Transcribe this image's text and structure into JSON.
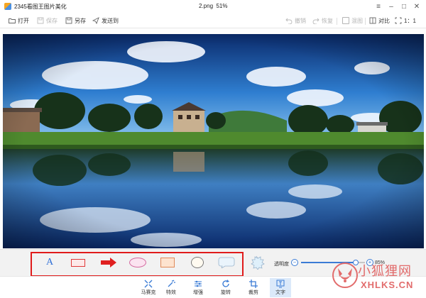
{
  "window": {
    "app_title": "2345看图王图片美化",
    "file_title": "2.png",
    "zoom": "51%"
  },
  "toolbar": {
    "open": "打开",
    "save": "保存",
    "save_as": "另存",
    "send_to": "发送到",
    "undo": "撤销",
    "redo": "恢复",
    "template": "混图",
    "compare": "对比",
    "ratio": "1：1"
  },
  "annotation": {
    "text_tool": "A",
    "opacity_label": "透明度",
    "opacity_value": "85%",
    "opacity_level": 0.85
  },
  "bottom_tabs": [
    {
      "label": "马赛克",
      "icon": "mosaic-icon"
    },
    {
      "label": "特效",
      "icon": "effects-icon"
    },
    {
      "label": "增强",
      "icon": "enhance-icon"
    },
    {
      "label": "旋转",
      "icon": "rotate-icon"
    },
    {
      "label": "裁剪",
      "icon": "crop-icon"
    },
    {
      "label": "文字",
      "icon": "text-icon",
      "active": true
    }
  ],
  "watermark": {
    "cn": "小狐狸网",
    "en": "XHLKS.CN"
  },
  "colors": {
    "accent": "#3a7bd5",
    "highlight_box": "#e01b1b",
    "watermark": "#e26c6c"
  }
}
